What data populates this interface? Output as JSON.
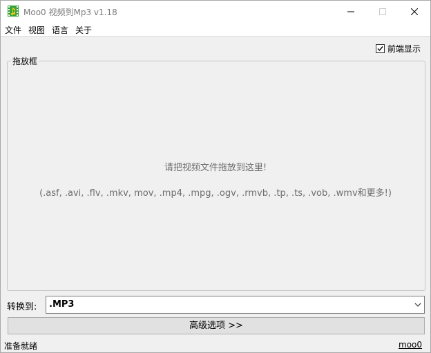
{
  "window": {
    "title": "Moo0 视频到Mp3 v1.18",
    "icon": "app-film-music-icon"
  },
  "title_buttons": {
    "minimize_icon": "minimize-icon",
    "maximize_icon": "maximize-icon",
    "close_icon": "close-icon"
  },
  "menu": {
    "items": [
      "文件",
      "视图",
      "语言",
      "关于"
    ]
  },
  "topmost": {
    "label": "前端显示",
    "checked": true
  },
  "dropzone": {
    "legend": "拖放框",
    "hint": "请把视频文件拖放到这里!",
    "formats": "(.asf, .avi, .flv, .mkv, mov, .mp4, .mpg, .ogv, .rmvb, .tp, .ts, .vob, .wmv和更多!)"
  },
  "convert": {
    "label": "转换到:",
    "selected": ".MP3"
  },
  "advanced_button": {
    "label": "高级选项 >>"
  },
  "status": {
    "text": "准备就绪",
    "link": "moo0"
  },
  "colors": {
    "title_text": "#7a7a7a",
    "hint_text": "#6d6d6d",
    "window_bg": "#f0f0f0",
    "icon_green": "#3aa23a",
    "icon_yellow": "#f2c81a"
  }
}
